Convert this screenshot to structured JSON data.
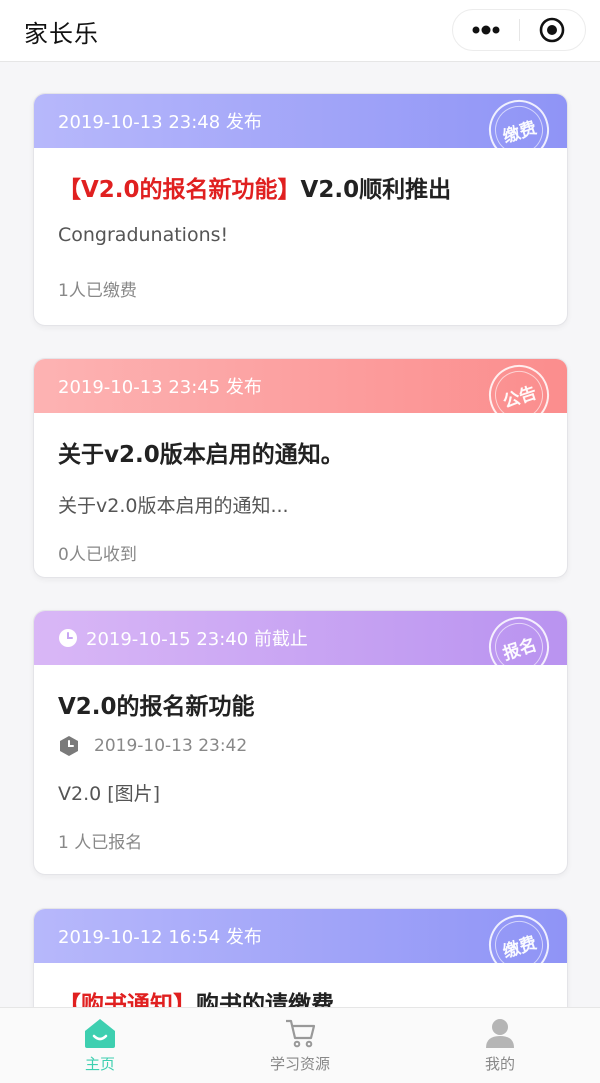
{
  "header": {
    "title": "家长乐"
  },
  "cards": [
    {
      "head_text": "2019-10-13 23:48 发布",
      "stamp": "缴费",
      "title_prefix": "【V2.0的报名新功能】",
      "title_main": "V2.0顺利推出",
      "desc": "Congradunations!",
      "count": "1人已缴费"
    },
    {
      "head_text": "2019-10-13 23:45 发布",
      "stamp": "公告",
      "title_main": "关于v2.0版本启用的通知。",
      "desc": "关于v2.0版本启用的通知...",
      "count": "0人已收到"
    },
    {
      "head_text": "2019-10-15 23:40 前截止",
      "stamp": "报名",
      "title_main": "V2.0的报名新功能",
      "date": "2019-10-13 23:42",
      "desc": "V2.0 [图片]",
      "count": "1 人已报名"
    },
    {
      "head_text": "2019-10-12 16:54 发布",
      "stamp": "缴费",
      "title_prefix": "【购书通知】",
      "title_main": "购书的请缴费"
    }
  ],
  "nav": [
    {
      "label": "主页",
      "icon": "home-icon",
      "active": true
    },
    {
      "label": "学习资源",
      "icon": "cart-icon",
      "active": false
    },
    {
      "label": "我的",
      "icon": "user-icon",
      "active": false
    }
  ],
  "colors": {
    "accent": "#3ecfb0",
    "blue_head": "#8f94f6",
    "red_head": "#fb8d8d",
    "purple_head": "#b993f0",
    "title_red": "#e02020"
  }
}
